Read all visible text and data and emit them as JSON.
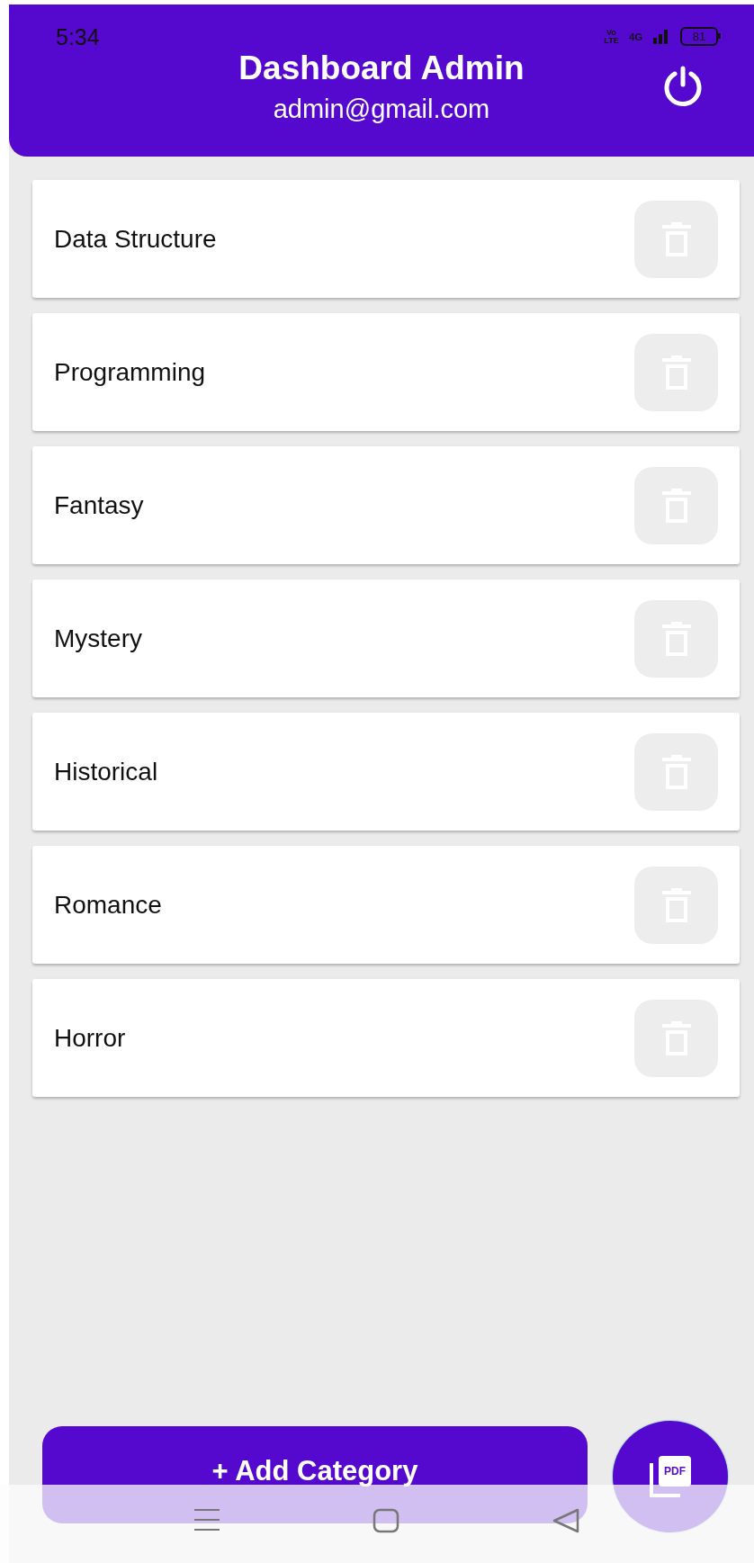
{
  "status_bar": {
    "time": "5:34",
    "volte": "Vo LTE",
    "network": "4G",
    "battery": "81"
  },
  "header": {
    "title": "Dashboard Admin",
    "subtitle": "admin@gmail.com"
  },
  "categories": [
    {
      "name": "Data Structure"
    },
    {
      "name": "Programming"
    },
    {
      "name": "Fantasy"
    },
    {
      "name": "Mystery"
    },
    {
      "name": "Historical"
    },
    {
      "name": "Romance"
    },
    {
      "name": "Horror"
    }
  ],
  "add_button": {
    "label": "+ Add Category"
  },
  "pdf_button": {
    "label": "PDF"
  }
}
